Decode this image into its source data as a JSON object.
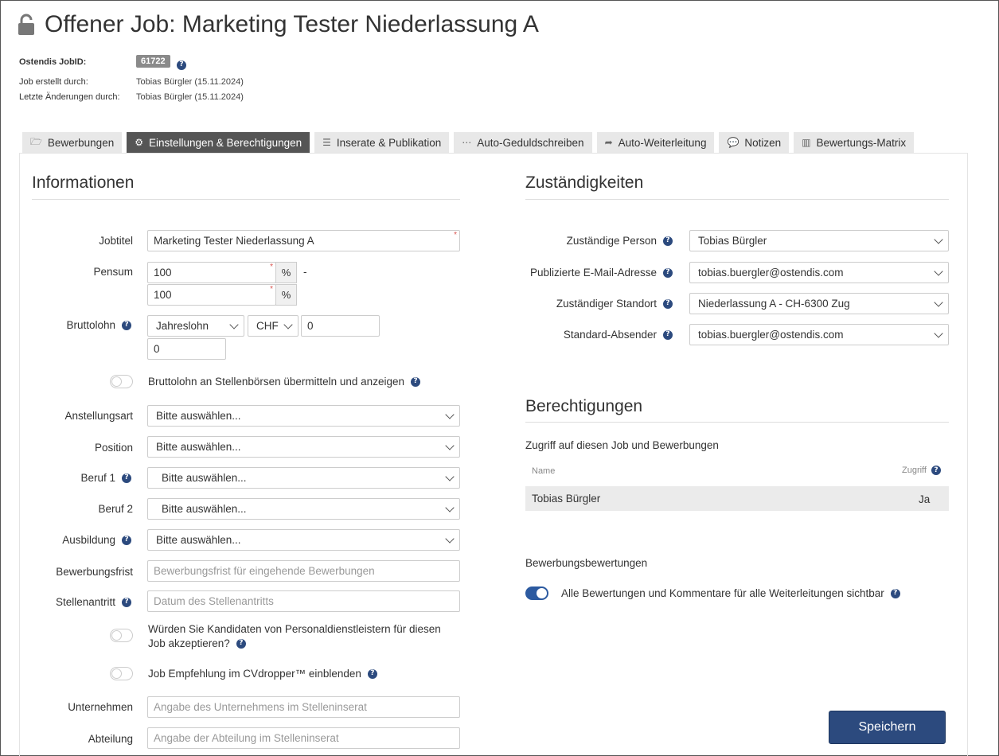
{
  "header": {
    "title": "Offener Job: Marketing Tester Niederlassung A",
    "meta": {
      "jobid_label": "Ostendis JobID:",
      "jobid_value": "61722",
      "created_label": "Job erstellt durch:",
      "created_value": "Tobias Bürgler (15.11.2024)",
      "changed_label": "Letzte Änderungen durch:",
      "changed_value": "Tobias Bürgler (15.11.2024)"
    }
  },
  "tabs": [
    {
      "label": "Bewerbungen",
      "icon": "folder-open-icon",
      "active": false
    },
    {
      "label": "Einstellungen & Berechtigungen",
      "icon": "gears-icon",
      "active": true
    },
    {
      "label": "Inserate & Publikation",
      "icon": "list-alt-icon",
      "active": false
    },
    {
      "label": "Auto-Geduldschreiben",
      "icon": "ellipsis-icon",
      "active": false
    },
    {
      "label": "Auto-Weiterleitung",
      "icon": "share-icon",
      "active": false
    },
    {
      "label": "Notizen",
      "icon": "comment-icon",
      "active": false
    },
    {
      "label": "Bewertungs-Matrix",
      "icon": "bar-chart-icon",
      "active": false
    }
  ],
  "info": {
    "title": "Informationen",
    "jobtitel_label": "Jobtitel",
    "jobtitel_value": "Marketing Tester Niederlassung A",
    "pensum_label": "Pensum",
    "pensum_min": "100",
    "pensum_max": "100",
    "pensum_unit": "%",
    "pensum_sep": "-",
    "bruttolohn_label": "Bruttolohn",
    "lohn_type": "Jahreslohn",
    "currency": "CHF",
    "lohn_min": "0",
    "lohn_max": "0",
    "bruttolohn_toggle_label": "Bruttolohn an Stellenbörsen übermitteln und anzeigen",
    "anstellungsart_label": "Anstellungsart",
    "anstellungsart_value": "Bitte auswählen...",
    "position_label": "Position",
    "position_value": "Bitte auswählen...",
    "beruf1_label": "Beruf 1",
    "beruf1_value": "Bitte auswählen...",
    "beruf2_label": "Beruf 2",
    "beruf2_value": "Bitte auswählen...",
    "ausbildung_label": "Ausbildung",
    "ausbildung_value": "Bitte auswählen...",
    "frist_label": "Bewerbungsfrist",
    "frist_placeholder": "Bewerbungsfrist für eingehende Bewerbungen",
    "antritt_label": "Stellenantritt",
    "antritt_placeholder": "Datum des Stellenantritts",
    "personal_toggle_line1": "Würden Sie Kandidaten von Personaldienstleistern für diesen",
    "personal_toggle_line2": "Job akzeptieren?",
    "cvdropper_toggle_label": "Job Empfehlung im CVdropper™ einblenden",
    "unternehmen_label": "Unternehmen",
    "unternehmen_placeholder": "Angabe des Unternehmens im Stelleninserat",
    "abteilung_label": "Abteilung",
    "abteilung_placeholder": "Angabe der Abteilung im Stelleninserat"
  },
  "zust": {
    "title": "Zuständigkeiten",
    "person_label": "Zuständige Person",
    "person_value": "Tobias Bürgler",
    "email_label": "Publizierte E-Mail-Adresse",
    "email_value": "tobias.buergler@ostendis.com",
    "standort_label": "Zuständiger Standort",
    "standort_value": "Niederlassung A - CH-6300 Zug",
    "absender_label": "Standard-Absender",
    "absender_value": "tobias.buergler@ostendis.com"
  },
  "berecht": {
    "title": "Berechtigungen",
    "subtitle": "Zugriff auf diesen Job und Bewerbungen",
    "col_name": "Name",
    "col_access": "Zugriff",
    "rows": [
      {
        "name": "Tobias Bürgler",
        "access": "Ja"
      }
    ],
    "bewertungen_title": "Bewerbungsbewertungen",
    "bewertungen_toggle_label": "Alle Bewertungen und Kommentare für alle Weiterleitungen sichtbar"
  },
  "actions": {
    "save_label": "Speichern"
  },
  "colors": {
    "primary": "#2c4a7e",
    "active_tab": "#555555",
    "required": "#d9534f"
  }
}
